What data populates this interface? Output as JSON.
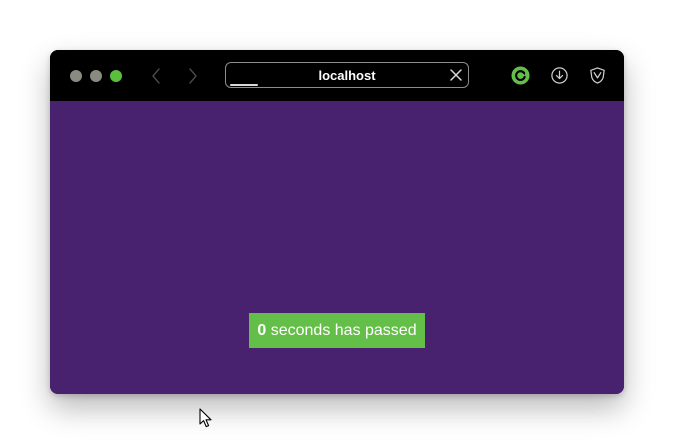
{
  "browser": {
    "url": "localhost",
    "load_progress": 0.12
  },
  "page": {
    "background_color": "#48216f",
    "toast": {
      "count": "0",
      "message": " seconds has passed",
      "color": "#63bf47"
    }
  },
  "icons": {
    "back": "chevron-left-icon",
    "forward": "chevron-right-icon",
    "clear": "close-icon",
    "reload": "reload-icon",
    "download": "download-icon",
    "shield": "shield-icon",
    "cursor": "mouse-pointer-icon"
  }
}
